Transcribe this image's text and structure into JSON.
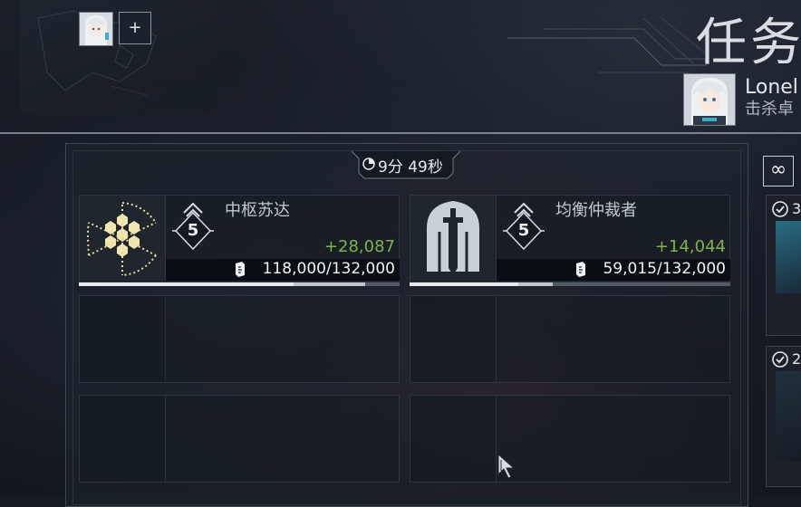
{
  "header": {
    "title": "任务",
    "player_name": "Lonel",
    "player_subtitle": "击杀卓"
  },
  "toolbar": {
    "add_label": "+"
  },
  "timer": {
    "label": "9分 49秒"
  },
  "bosses": [
    {
      "name": "中枢苏达",
      "rank": "5",
      "gain": "+28,087",
      "score": "118,000/132,000",
      "progress": 0.894,
      "progress_prev": 0.67,
      "icon": "hexagon-core-icon"
    },
    {
      "name": "均衡仲裁者",
      "rank": "5",
      "gain": "+14,044",
      "score": "59,015/132,000",
      "progress": 0.447,
      "progress_prev": 0.34,
      "icon": "sword-shield-icon"
    }
  ],
  "side_panel": {
    "infinity_label": "∞",
    "cards": [
      {
        "num": "3",
        "icon": "check-circle-icon"
      },
      {
        "num": "2",
        "icon": "check-circle-icon"
      }
    ]
  },
  "colors": {
    "gain": "#7fb347",
    "text": "#f1f3f5",
    "bar_track": "#525a64",
    "bar_fill": "#e8ebee"
  }
}
